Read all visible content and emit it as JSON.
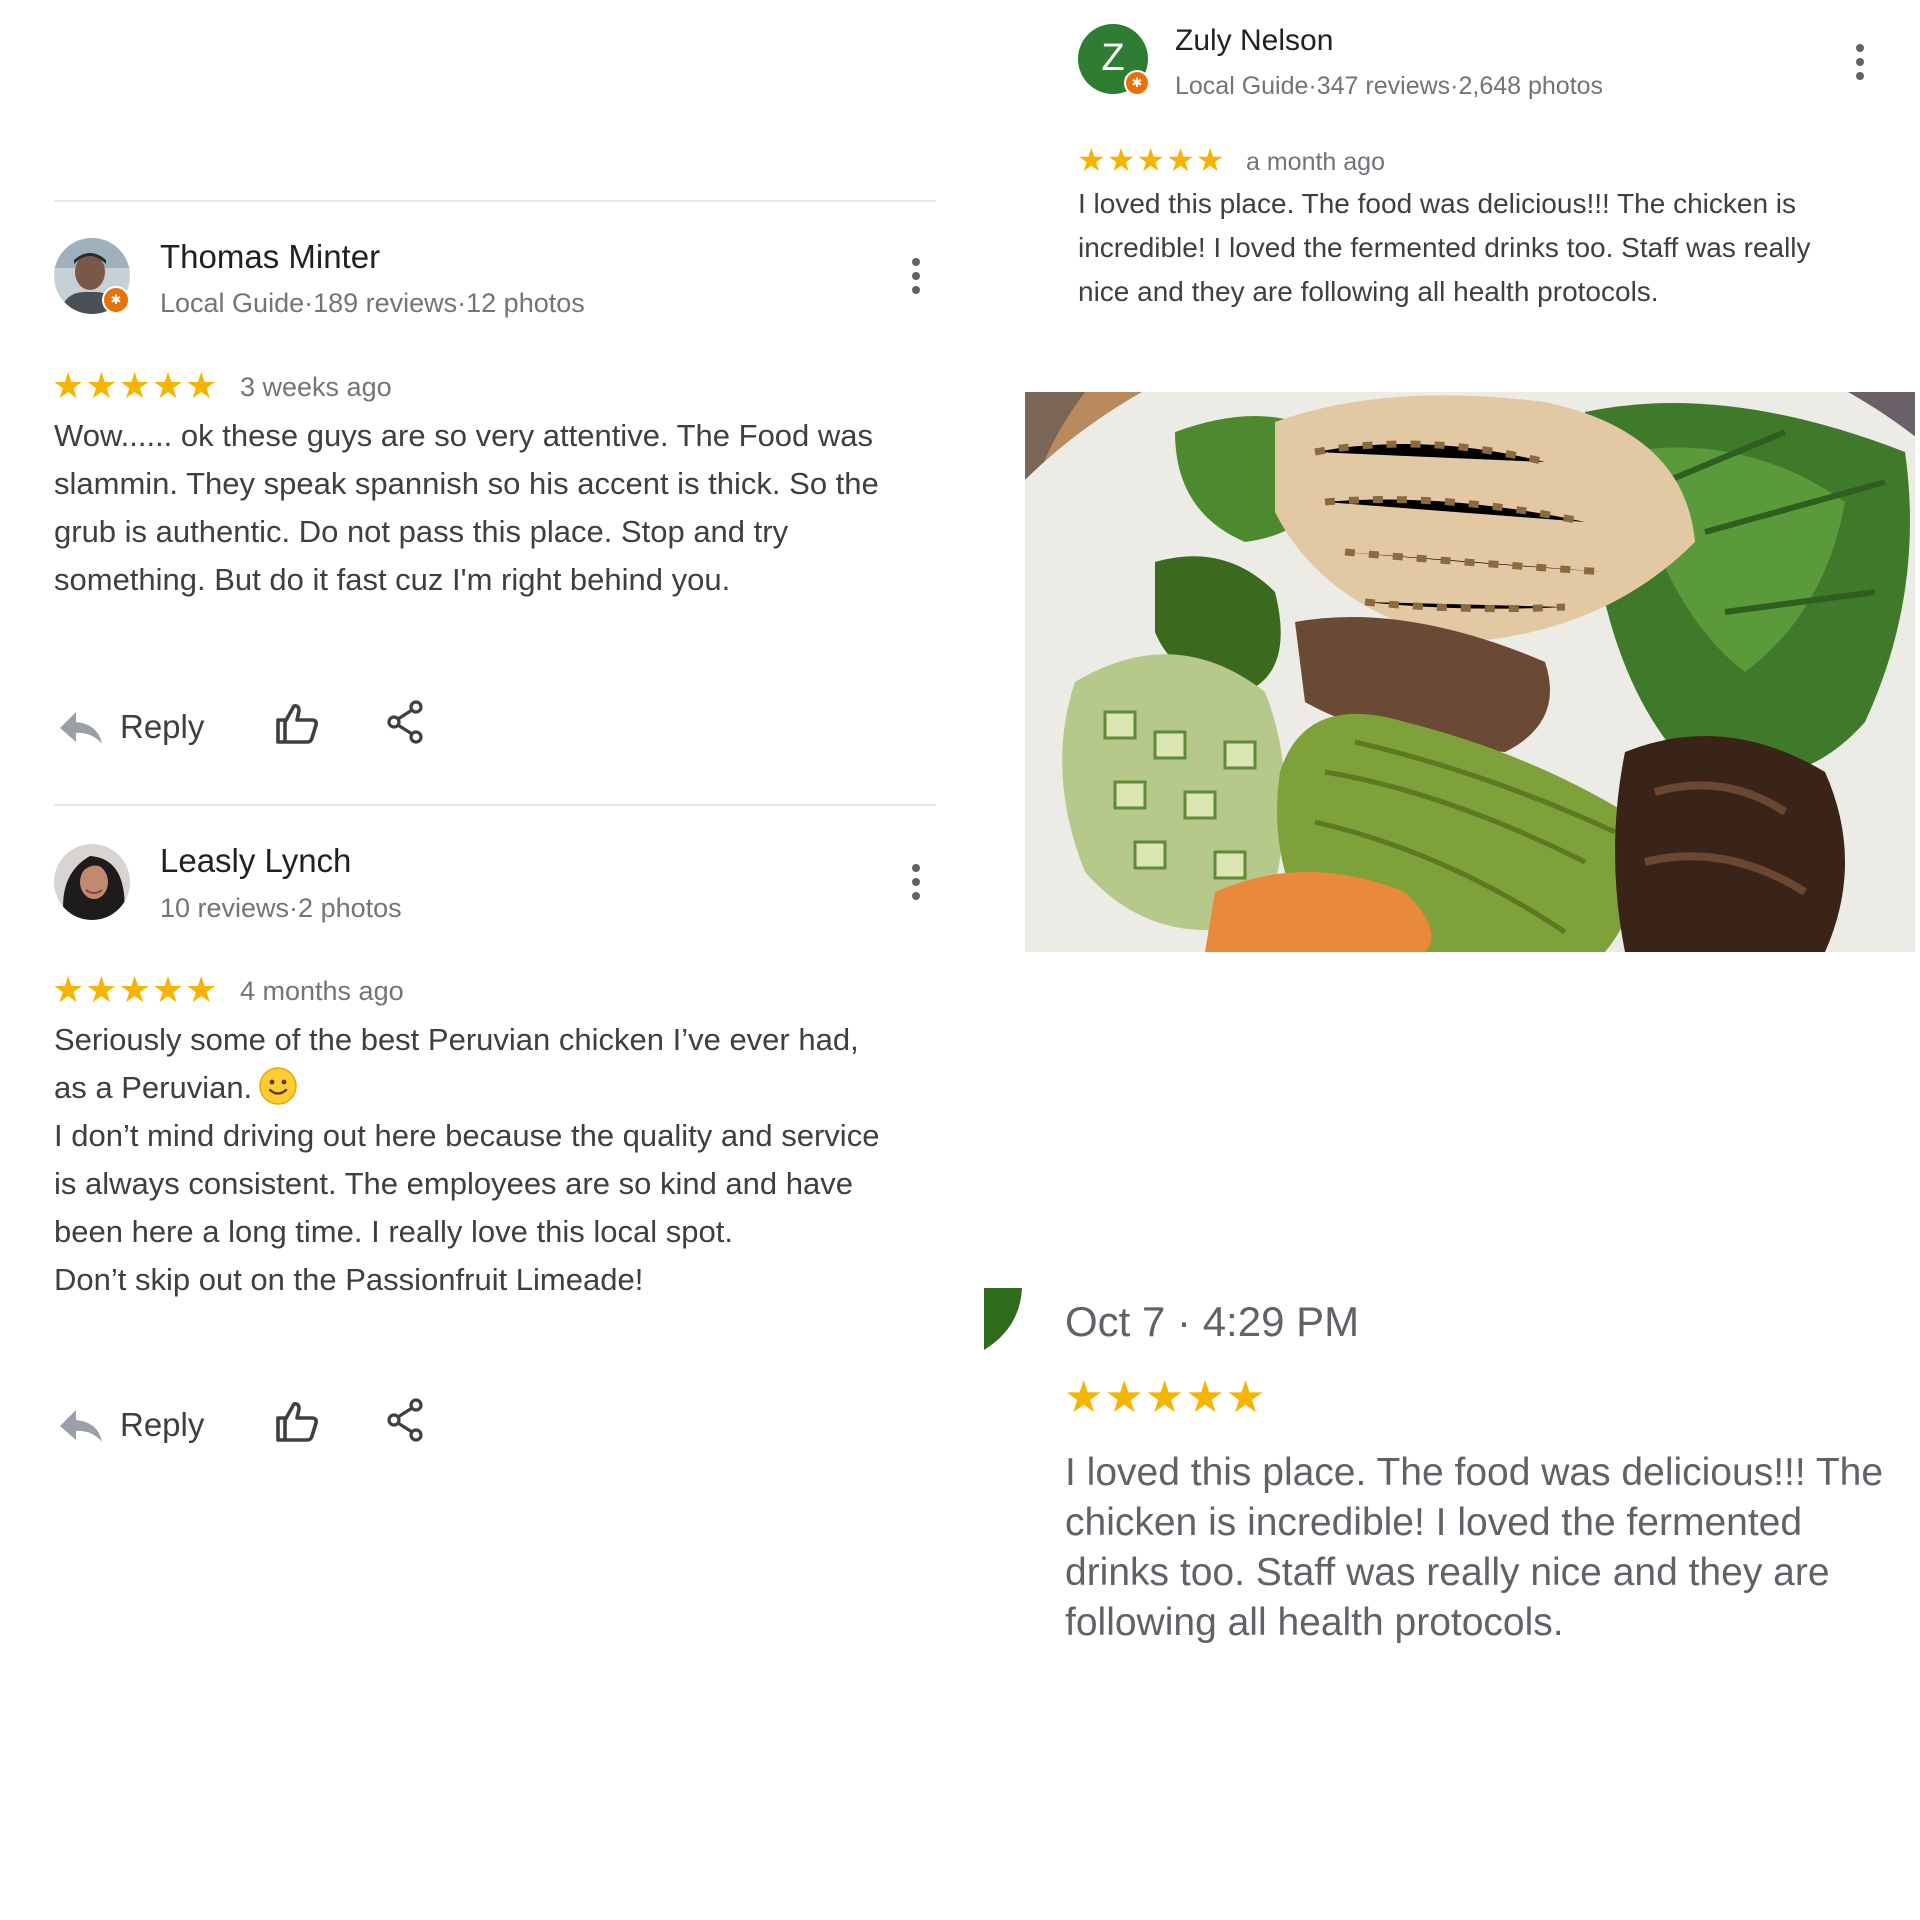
{
  "reviews": [
    {
      "name": "Thomas Minter",
      "meta": "Local Guide·189 reviews·12 photos",
      "stars": "★★★★★",
      "when": "3 weeks ago",
      "text": "Wow...... ok these guys are so very attentive. The Food was slammin. They speak spannish so his accent is thick. So the grub is authentic. Do not pass this place. Stop and try something. But do it fast cuz I'm right behind you.",
      "reply_label": "Reply"
    },
    {
      "name": "Leasly Lynch",
      "meta": "10 reviews·2 photos",
      "stars": "★★★★★",
      "when": "4 months ago",
      "text_line1": "Seriously some of the best Peruvian chicken I’ve ever had, as a Peruvian.",
      "text_line2": "I don’t mind driving out here because the quality and service is always consistent. The employees are so kind and have been here a long time. I really love this local spot.",
      "text_line3": "Don’t skip out on the Passionfruit Limeade!",
      "reply_label": "Reply"
    }
  ],
  "featured_review": {
    "avatar_letter": "Z",
    "name": "Zuly Nelson",
    "meta": "Local Guide·347 reviews·2,648 photos",
    "stars": "★★★★★",
    "when": "a month ago",
    "text": "I loved this place. The food was delicious!!! The chicken is incredible! I loved the fermented drinks too. Staff was really nice and they are following all health protocols."
  },
  "owner_view": {
    "date": "Oct 7 · 4:29 PM",
    "stars": "★★★★★",
    "text": "I loved this place. The food was delicious!!! The chicken is incredible! I loved the fermented drinks too. Staff was really nice and they are following all health protocols."
  },
  "colors": {
    "star": "#f4b400",
    "avatar_green": "#2e7d32",
    "guide_badge": "#e8710a"
  },
  "icons": [
    "kebab-menu-icon",
    "reply-arrow-icon",
    "thumbs-up-icon",
    "share-icon",
    "local-guide-badge-icon",
    "smiling-face-emoji"
  ]
}
